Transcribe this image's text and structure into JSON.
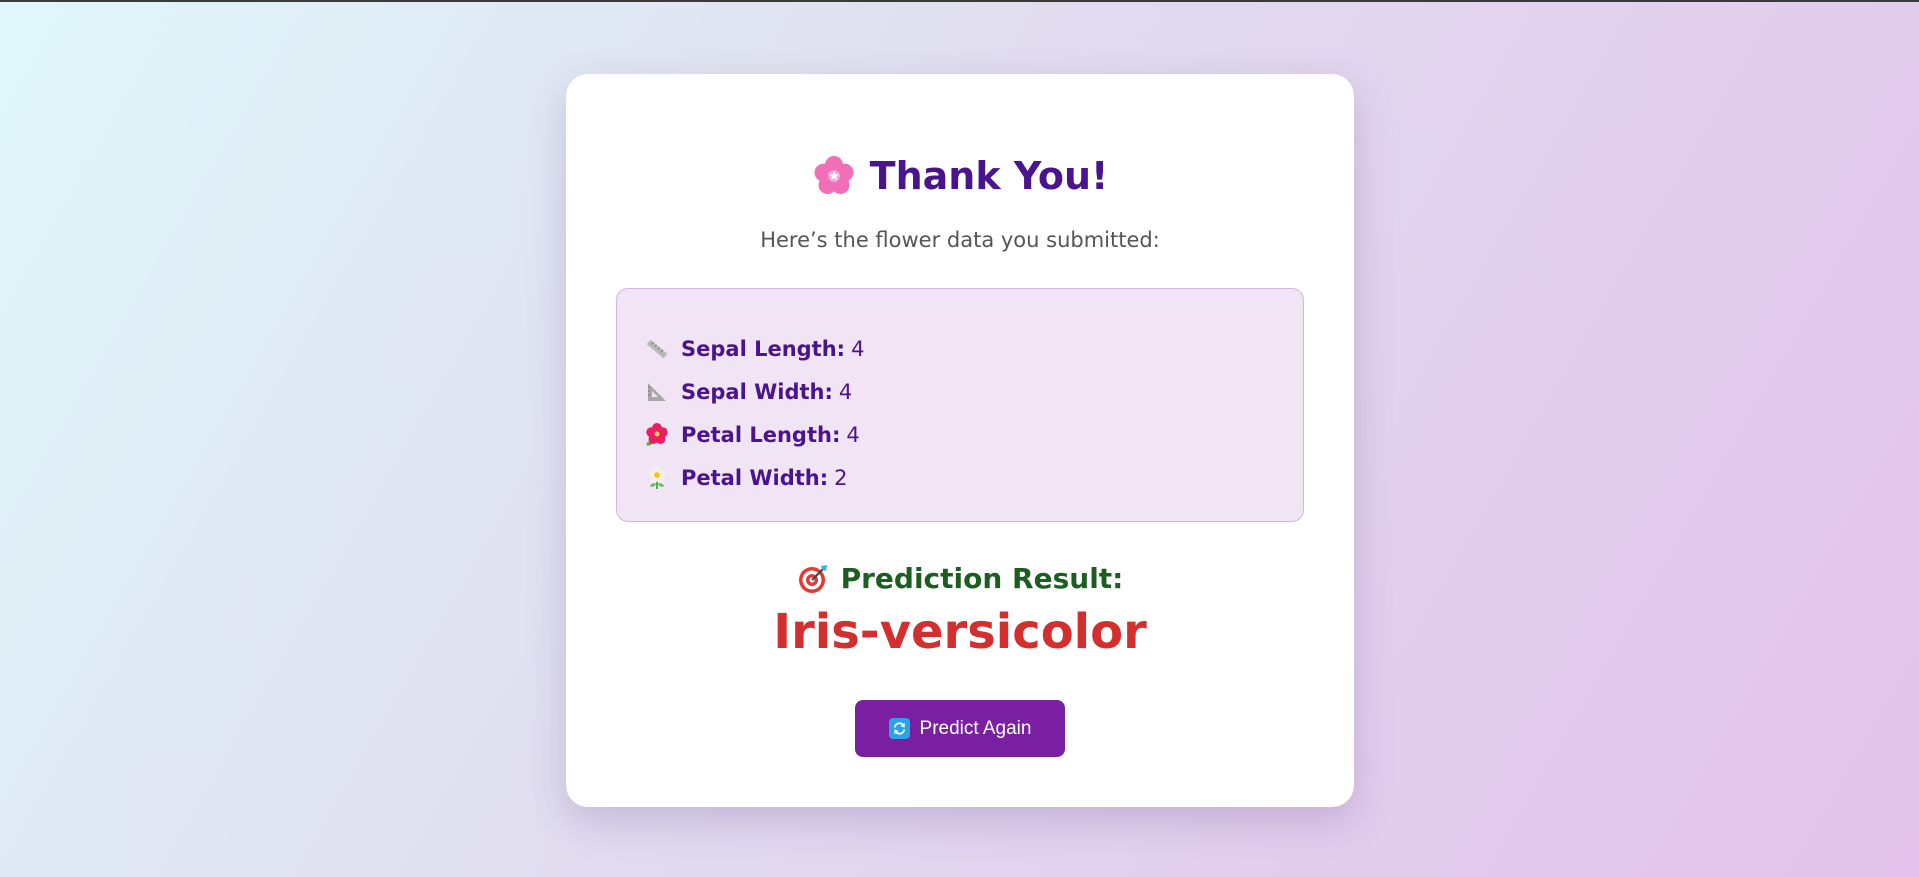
{
  "heading": {
    "icon": "cherry-blossom-icon",
    "title": "Thank You!",
    "subtitle": "Here’s the flower data you submitted:"
  },
  "measurements": [
    {
      "icon": "ruler-icon",
      "label": "Sepal Length:",
      "value": "4"
    },
    {
      "icon": "triangular-ruler-icon",
      "label": "Sepal Width:",
      "value": "4"
    },
    {
      "icon": "hibiscus-icon",
      "label": "Petal Length:",
      "value": "4"
    },
    {
      "icon": "daisy-icon",
      "label": "Petal Width:",
      "value": "2"
    }
  ],
  "prediction": {
    "icon": "target-icon",
    "label": "Prediction Result:",
    "value": "Iris-versicolor"
  },
  "action": {
    "icon": "refresh-icon",
    "label": "Predict Again"
  },
  "colors": {
    "title": "#4a148c",
    "prediction_label": "#1b5e20",
    "prediction_value": "#d32f2f",
    "button": "#7b1fa2",
    "data_box": "#f1e4f5"
  }
}
